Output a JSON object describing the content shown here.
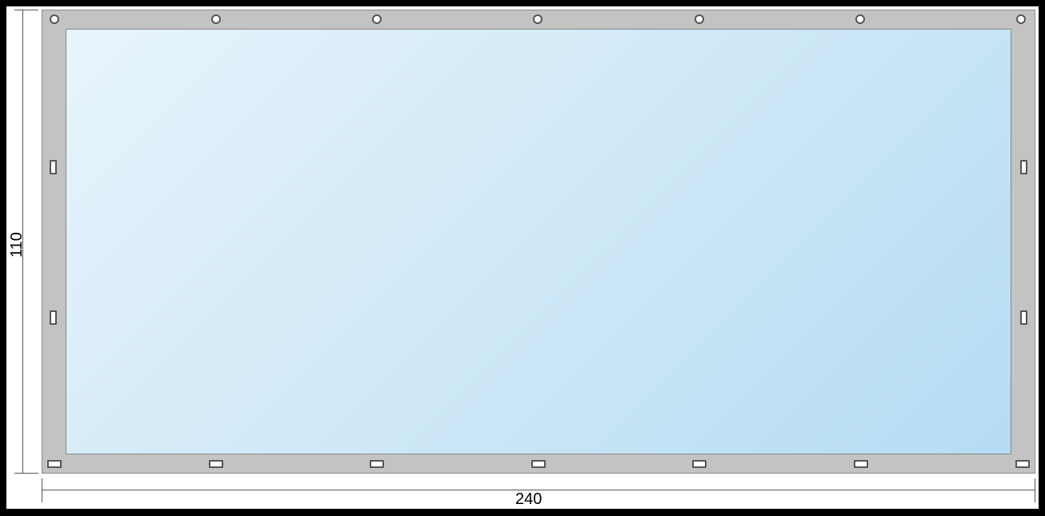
{
  "dimensions": {
    "height_label": "110",
    "width_label": "240"
  },
  "panel": {
    "frame_color": "#c3c3c3",
    "inner_gradient_start": "#e8f4fb",
    "inner_gradient_end": "#b5dcf3"
  },
  "eyelets": {
    "top_count": 7,
    "top_type": "round",
    "bottom_count": 7,
    "bottom_type": "rect",
    "left_count": 2,
    "left_type": "rect-vertical",
    "right_count": 2,
    "right_type": "rect-vertical"
  }
}
